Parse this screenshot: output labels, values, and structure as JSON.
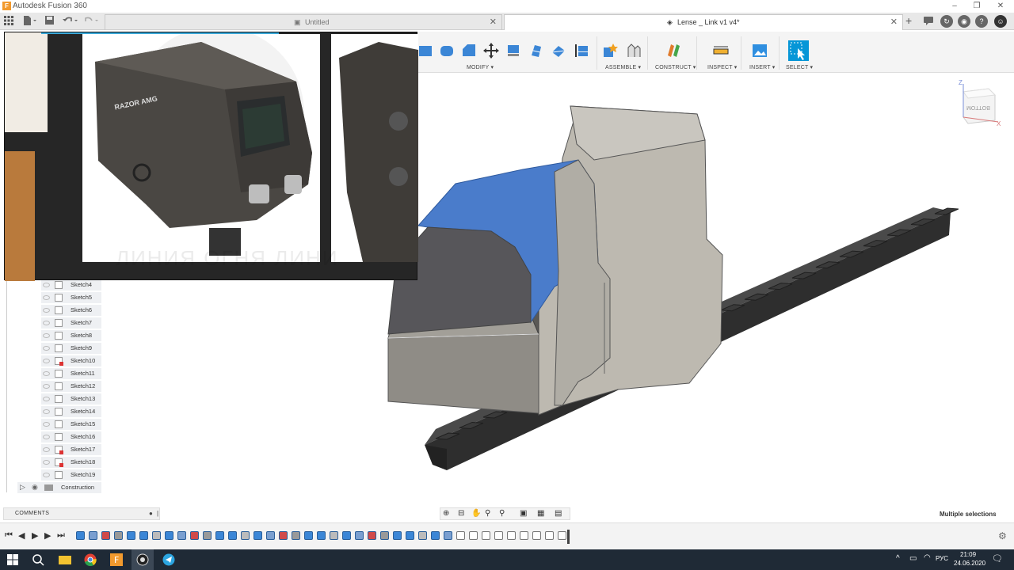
{
  "window": {
    "app_title": "Autodesk Fusion 360",
    "app_icon": "F"
  },
  "tabs": [
    {
      "label": "Untitled"
    },
    {
      "label": "Lense _ Link v1 v4*"
    }
  ],
  "toolbar": {
    "groups": [
      "MODIFY ▾",
      "ASSEMBLE ▾",
      "CONSTRUCT ▾",
      "INSPECT ▾",
      "INSERT ▾",
      "SELECT ▾"
    ]
  },
  "browser": {
    "sketches": [
      "Sketch4",
      "Sketch5",
      "Sketch6",
      "Sketch7",
      "Sketch8",
      "Sketch9",
      "Sketch10",
      "Sketch11",
      "Sketch12",
      "Sketch13",
      "Sketch14",
      "Sketch15",
      "Sketch16",
      "Sketch17",
      "Sketch18",
      "Sketch19"
    ],
    "folder": "Construction"
  },
  "reference_image": {
    "brand": "RAZOR AMG",
    "watermark": "ЛИНИЯ ОГНЯ ЛИНИ"
  },
  "viewcube": {
    "face": "BOTTOM",
    "axis_z": "Z",
    "axis_x": "X"
  },
  "comments": {
    "label": "COMMENTS"
  },
  "status": {
    "selection": "Multiple selections"
  },
  "taskbar": {
    "lang": "РУС",
    "time": "21:09",
    "date": "24.06.2020"
  },
  "colors": {
    "selected_face": "#4a7ccb",
    "model_body": "#b7b3ab",
    "rail": "#3d3d3d",
    "accent_blue": "#0696d7"
  }
}
